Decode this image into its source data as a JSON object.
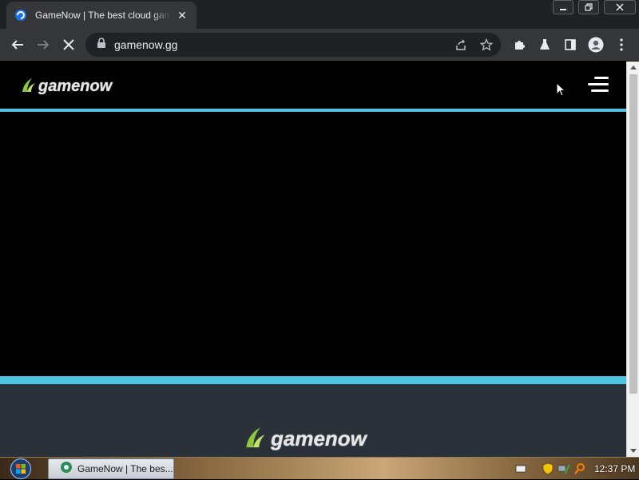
{
  "browser": {
    "tab_title": "GameNow | The best cloud gaming",
    "tab_close": "✕",
    "url": "gamenow.gg",
    "window_controls": {
      "minimize": "minimize-icon",
      "restore": "restore-icon",
      "close": "close-icon"
    }
  },
  "site": {
    "logo_text": "gamenow",
    "footer_logo_text": "gamenow",
    "colors": {
      "accent_stripe": "#4fc3e4",
      "logo_green": "#8dc63f",
      "footer_bg": "#2b3139"
    }
  },
  "taskbar": {
    "task_label": "GameNow | The bes...",
    "clock": "12:37 PM"
  }
}
